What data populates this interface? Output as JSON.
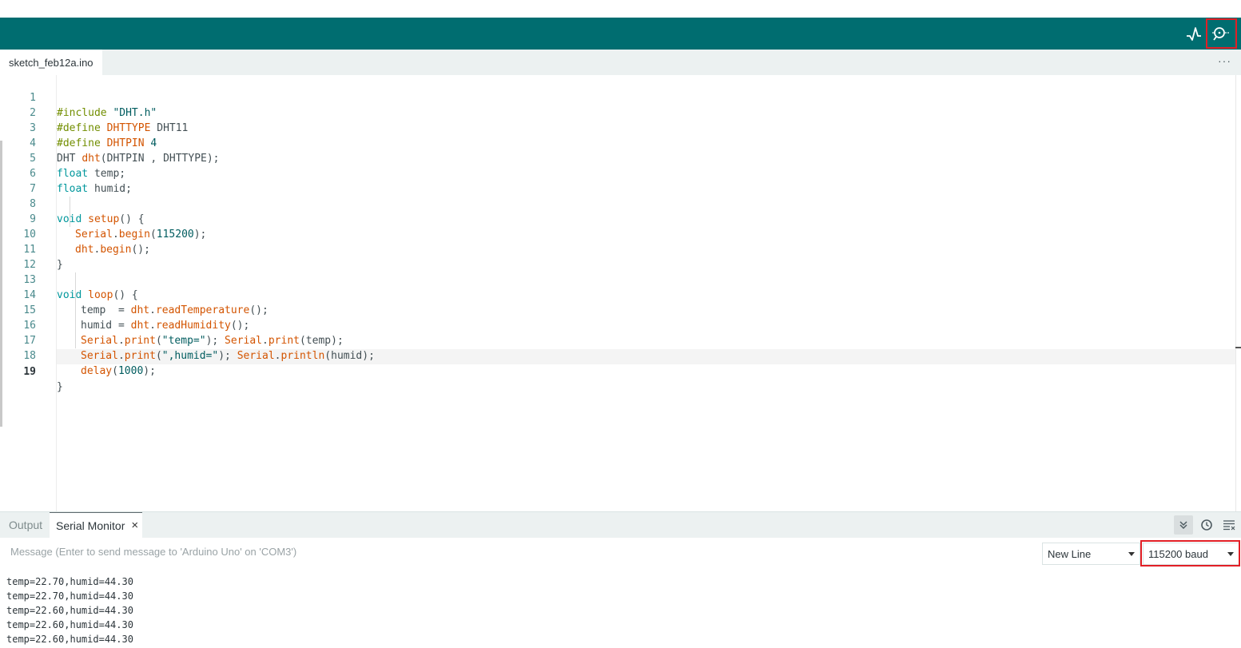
{
  "toolbar": {
    "plotter_icon": "serial-plotter-icon",
    "monitor_icon": "serial-monitor-icon",
    "accent": "#006d70",
    "highlight_color": "#e21f26"
  },
  "tabs": {
    "file": "sketch_feb12a.ino",
    "more": "···"
  },
  "editor": {
    "lines": [
      {
        "n": "1"
      },
      {
        "n": "2"
      },
      {
        "n": "3"
      },
      {
        "n": "4"
      },
      {
        "n": "5"
      },
      {
        "n": "6"
      },
      {
        "n": "7"
      },
      {
        "n": "8"
      },
      {
        "n": "9"
      },
      {
        "n": "10"
      },
      {
        "n": "11"
      },
      {
        "n": "12"
      },
      {
        "n": "13"
      },
      {
        "n": "14"
      },
      {
        "n": "15"
      },
      {
        "n": "16"
      },
      {
        "n": "17"
      },
      {
        "n": "18"
      },
      {
        "n": "19"
      }
    ],
    "tokens": {
      "l1": [
        "#include",
        " ",
        "\"DHT.h\""
      ],
      "l2": [
        "#define",
        " ",
        "DHTTYPE",
        " DHT11"
      ],
      "l3": [
        "#define",
        " ",
        "DHTPIN",
        " ",
        "4"
      ],
      "l4": [
        "DHT ",
        "dht",
        "(DHTPIN , DHTTYPE);"
      ],
      "l5": [
        "float",
        " temp;"
      ],
      "l6": [
        "float",
        " humid;"
      ],
      "l8": [
        "void",
        " ",
        "setup",
        "() {"
      ],
      "l9": [
        "Serial",
        ".",
        "begin",
        "(",
        "115200",
        ");"
      ],
      "l10": [
        "dht",
        ".",
        "begin",
        "();"
      ],
      "l11": [
        "}"
      ],
      "l13": [
        "void",
        " ",
        "loop",
        "() {"
      ],
      "l14": [
        "temp  = ",
        "dht",
        ".",
        "readTemperature",
        "();"
      ],
      "l15": [
        "humid = ",
        "dht",
        ".",
        "readHumidity",
        "();"
      ],
      "l16": [
        "Serial",
        ".",
        "print",
        "(",
        "\"temp=\"",
        "); ",
        "Serial",
        ".",
        "print",
        "(temp);"
      ],
      "l17": [
        "Serial",
        ".",
        "print",
        "(",
        "\",humid=\"",
        "); ",
        "Serial",
        ".",
        "println",
        "(humid);"
      ],
      "l18": [
        "delay",
        "(",
        "1000",
        ");"
      ],
      "l19": [
        "}"
      ]
    }
  },
  "panel": {
    "tab_output": "Output",
    "tab_serial": "Serial Monitor",
    "close": "×",
    "message_placeholder": "Message (Enter to send message to 'Arduino Uno' on 'COM3')",
    "line_ending": "New Line",
    "baud": "115200 baud",
    "icons": [
      "autoscroll-icon",
      "timestamp-icon",
      "clear-output-icon"
    ],
    "output": [
      "temp=22.70,humid=44.30",
      "temp=22.70,humid=44.30",
      "temp=22.60,humid=44.30",
      "temp=22.60,humid=44.30",
      "temp=22.60,humid=44.30"
    ]
  }
}
